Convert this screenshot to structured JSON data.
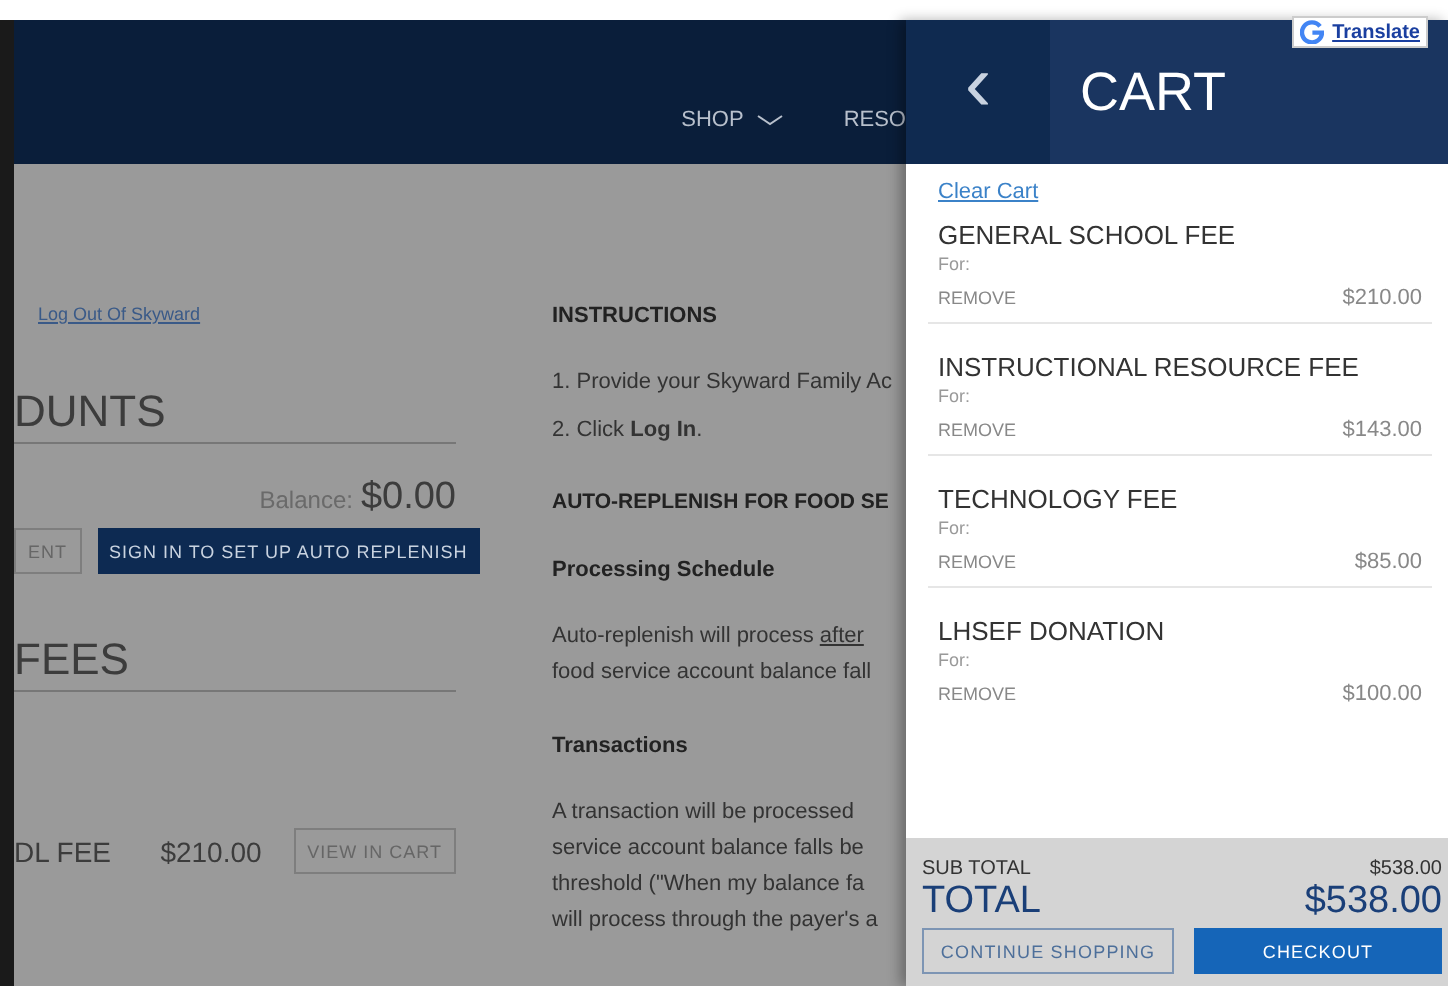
{
  "nav": [
    {
      "label": "SHOP",
      "dropdown": true
    },
    {
      "label": "RESO",
      "dropdown": false
    }
  ],
  "account": {
    "logout_link": "Log Out Of Skyward",
    "heading": "DUNTS",
    "balance_label": "Balance:",
    "balance": "$0.00",
    "buttons": [
      {
        "label": "ENT",
        "kind": "outline"
      },
      {
        "label": "SIGN IN TO SET UP AUTO REPLENISH",
        "kind": "solid"
      }
    ]
  },
  "fees": {
    "heading": "FEES",
    "rows": [
      {
        "name": "DL FEE",
        "amount": "$210.00",
        "button": "VIEW IN CART"
      }
    ]
  },
  "instructions": {
    "heading": "INSTRUCTIONS",
    "steps": [
      {
        "text": "1. Provide your Skyward Family Ac"
      },
      {
        "text": "2. Click **Log In**."
      }
    ],
    "sections": [
      {
        "kind": "caps",
        "text": "AUTO-REPLENISH FOR FOOD SE"
      },
      {
        "kind": "sub",
        "text": "Processing Schedule"
      },
      {
        "kind": "para",
        "lines": [
          "Auto-replenish will process ",
          "food service account balance fall"
        ],
        "link": "after"
      },
      {
        "kind": "sub",
        "text": "Transactions"
      },
      {
        "kind": "para",
        "lines": [
          "A transaction will be processed ",
          "service account balance falls be",
          "threshold (\"When my balance fa",
          "will process through the payer's a"
        ]
      }
    ]
  },
  "cart": {
    "title": "CART",
    "back": "‹",
    "translate": "Translate",
    "clear": "Clear Cart",
    "items": [
      {
        "name": "GENERAL SCHOOL FEE",
        "for": "For:",
        "remove": "REMOVE",
        "price": "$210.00"
      },
      {
        "name": "INSTRUCTIONAL RESOURCE FEE",
        "for": "For:",
        "remove": "REMOVE",
        "price": "$143.00"
      },
      {
        "name": "TECHNOLOGY FEE",
        "for": "For:",
        "remove": "REMOVE",
        "price": "$85.00"
      },
      {
        "name": "LHSEF DONATION",
        "for": "For:",
        "remove": "REMOVE",
        "price": "$100.00"
      }
    ],
    "subtotal_label": "SUB TOTAL",
    "subtotal": "$538.00",
    "total_label": "TOTAL",
    "total": "$538.00",
    "continue": "CONTINUE SHOPPING",
    "checkout": "CHECKOUT"
  }
}
